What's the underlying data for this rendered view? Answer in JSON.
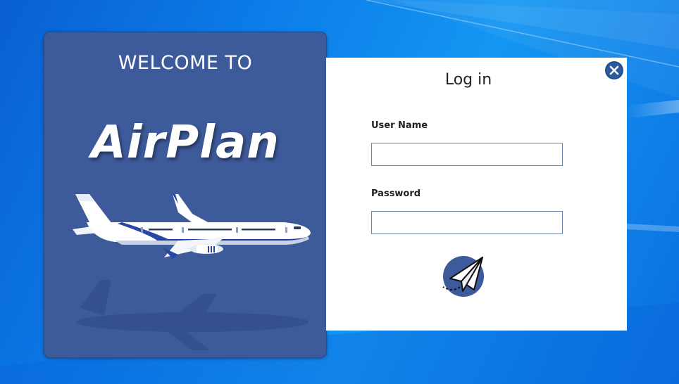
{
  "welcome": {
    "heading": "WELCOME TO",
    "brand": "AirPlan"
  },
  "login": {
    "title": "Log in",
    "username": {
      "label": "User Name",
      "value": "",
      "placeholder": ""
    },
    "password": {
      "label": "Password",
      "value": "",
      "placeholder": ""
    },
    "close_icon": "close-icon",
    "submit_icon": "paper-plane-icon"
  },
  "colors": {
    "panel_blue": "#3d5a9a",
    "accent_blue": "#2c5a9a",
    "desktop_blue": "#0b7be8",
    "white": "#ffffff"
  }
}
